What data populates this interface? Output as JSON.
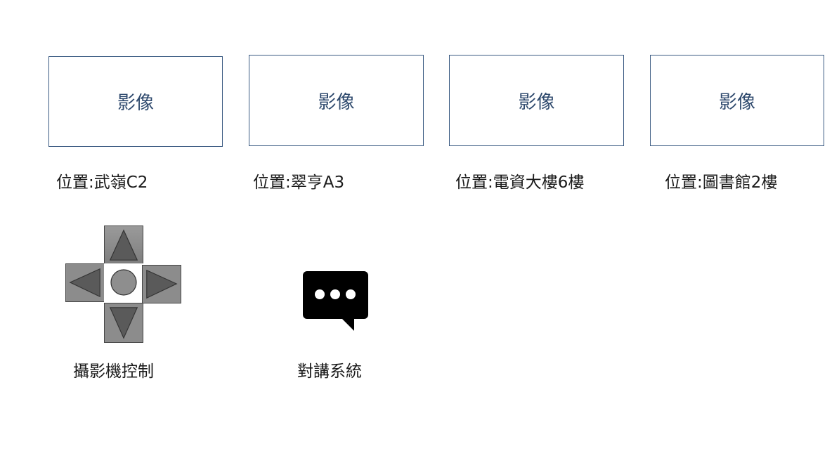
{
  "cameras": [
    {
      "video_label": "影像",
      "location": "位置:武嶺C2"
    },
    {
      "video_label": "影像",
      "location": "位置:翠亨A3"
    },
    {
      "video_label": "影像",
      "location": "位置:電資大樓6樓"
    },
    {
      "video_label": "影像",
      "location": "位置:圖書館2樓"
    }
  ],
  "controls": {
    "camera_control_label": "攝影機控制",
    "intercom_label": "對講系統"
  },
  "icons": {
    "dpad": [
      "arrow-up-icon",
      "arrow-left-icon",
      "center-circle-icon",
      "arrow-right-icon",
      "arrow-down-icon"
    ],
    "intercom": "chat-bubble-icon"
  },
  "colors": {
    "video_border": "#3a5a82",
    "video_text": "#2f4a6e",
    "dpad_fill": "#8c8c8c",
    "chat_icon": "#000000"
  }
}
